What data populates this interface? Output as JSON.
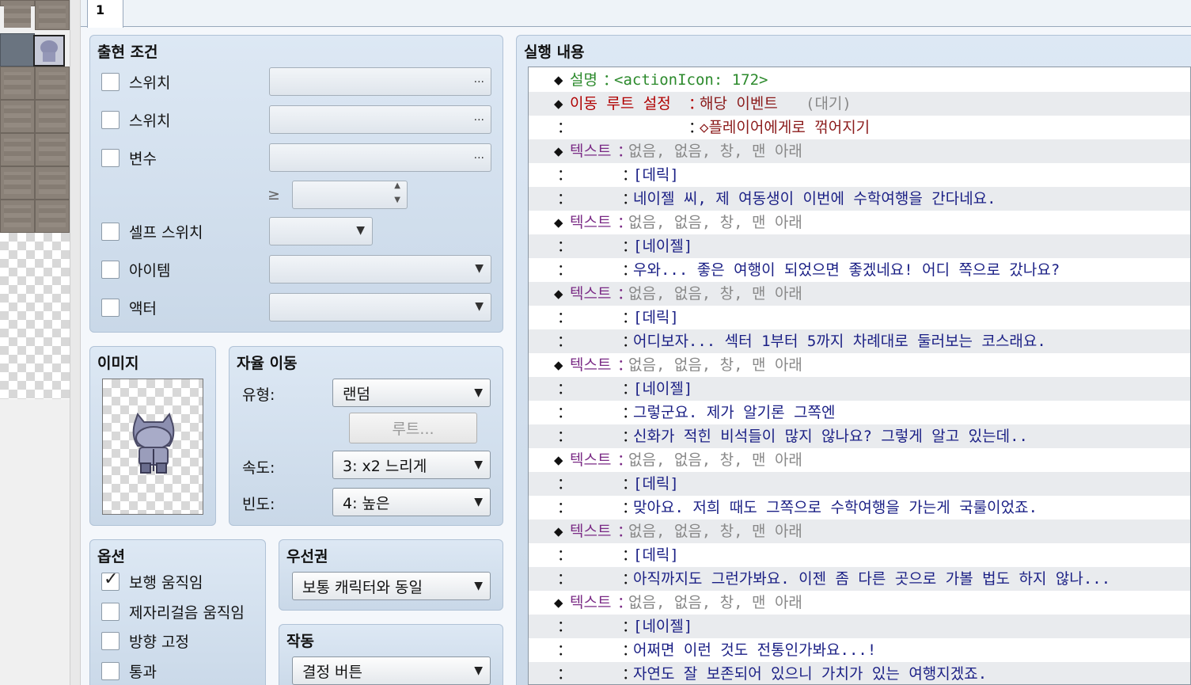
{
  "tab": {
    "label": "1"
  },
  "conditions": {
    "title": "출현 조건",
    "switch1": "스위치",
    "switch2": "스위치",
    "variable": "변수",
    "ge_symbol": "≥",
    "self_switch": "셀프 스위치",
    "item": "아이템",
    "actor": "액터",
    "dots": "..."
  },
  "image": {
    "title": "이미지"
  },
  "autonomous": {
    "title": "자율 이동",
    "type_label": "유형:",
    "type_value": "랜덤",
    "route_button": "루트...",
    "speed_label": "속도:",
    "speed_value": "3: x2 느리게",
    "freq_label": "빈도:",
    "freq_value": "4: 높은"
  },
  "options": {
    "title": "옵션",
    "walking": "보행 움직임",
    "stepping": "제자리걸음 움직임",
    "direction_fix": "방향 고정",
    "through": "통과",
    "walking_checked": true
  },
  "priority": {
    "title": "우선권",
    "value": "보통 캐릭터와 동일"
  },
  "trigger": {
    "title": "작동",
    "value": "결정 버튼"
  },
  "contents": {
    "title": "실행 내용",
    "rows": [
      {
        "bullet": "◆",
        "cmd": "설명",
        "style": "cmdg",
        "sep": "：",
        "args": "<actionIcon: 172>",
        "args_style": "cmdg",
        "extra": ""
      },
      {
        "bullet": "◆",
        "cmd": "이동 루트 설정",
        "style": "cmdr",
        "sep": "：",
        "args": "해당 이벤트 ",
        "args_style": "red",
        "extra": "(대기)"
      },
      {
        "bullet": "：",
        "cmd": "",
        "style": "cm",
        "sep": "：",
        "args": "◇플레이어에게로 꺾어지기",
        "args_style": "red",
        "extra": "",
        "indent": "wide"
      },
      {
        "bullet": "◆",
        "cmd": "텍스트",
        "style": "cmd",
        "sep": "：",
        "args": "없음, 없음, 창, 맨 아래",
        "args_style": "gray",
        "extra": ""
      },
      {
        "bullet": "：",
        "cmd": "",
        "style": "cm",
        "sep": "：",
        "args": "[데릭]",
        "args_style": "txt",
        "extra": ""
      },
      {
        "bullet": "：",
        "cmd": "",
        "style": "cm",
        "sep": "：",
        "args": "네이젤 씨, 제 여동생이 이번에 수학여행을 간다네요.",
        "args_style": "txt",
        "extra": ""
      },
      {
        "bullet": "◆",
        "cmd": "텍스트",
        "style": "cmd",
        "sep": "：",
        "args": "없음, 없음, 창, 맨 아래",
        "args_style": "gray",
        "extra": ""
      },
      {
        "bullet": "：",
        "cmd": "",
        "style": "cm",
        "sep": "：",
        "args": "[네이젤]",
        "args_style": "txt",
        "extra": ""
      },
      {
        "bullet": "：",
        "cmd": "",
        "style": "cm",
        "sep": "：",
        "args": "우와... 좋은 여행이 되었으면 좋겠네요! 어디 쪽으로 갔나요?",
        "args_style": "txt",
        "extra": ""
      },
      {
        "bullet": "◆",
        "cmd": "텍스트",
        "style": "cmd",
        "sep": "：",
        "args": "없음, 없음, 창, 맨 아래",
        "args_style": "gray",
        "extra": ""
      },
      {
        "bullet": "：",
        "cmd": "",
        "style": "cm",
        "sep": "：",
        "args": "[데릭]",
        "args_style": "txt",
        "extra": ""
      },
      {
        "bullet": "：",
        "cmd": "",
        "style": "cm",
        "sep": "：",
        "args": "어디보자... 섹터 1부터 5까지 차례대로 둘러보는 코스래요.",
        "args_style": "txt",
        "extra": ""
      },
      {
        "bullet": "◆",
        "cmd": "텍스트",
        "style": "cmd",
        "sep": "：",
        "args": "없음, 없음, 창, 맨 아래",
        "args_style": "gray",
        "extra": ""
      },
      {
        "bullet": "：",
        "cmd": "",
        "style": "cm",
        "sep": "：",
        "args": "[네이젤]",
        "args_style": "txt",
        "extra": ""
      },
      {
        "bullet": "：",
        "cmd": "",
        "style": "cm",
        "sep": "：",
        "args": "그렇군요. 제가 알기론 그쪽엔",
        "args_style": "txt",
        "extra": ""
      },
      {
        "bullet": "：",
        "cmd": "",
        "style": "cm",
        "sep": "：",
        "args": "신화가 적힌 비석들이 많지 않나요? 그렇게 알고 있는데..",
        "args_style": "txt",
        "extra": ""
      },
      {
        "bullet": "◆",
        "cmd": "텍스트",
        "style": "cmd",
        "sep": "：",
        "args": "없음, 없음, 창, 맨 아래",
        "args_style": "gray",
        "extra": ""
      },
      {
        "bullet": "：",
        "cmd": "",
        "style": "cm",
        "sep": "：",
        "args": "[데릭]",
        "args_style": "txt",
        "extra": ""
      },
      {
        "bullet": "：",
        "cmd": "",
        "style": "cm",
        "sep": "：",
        "args": "맞아요. 저희 때도 그쪽으로 수학여행을 가는게 국룰이었죠.",
        "args_style": "txt",
        "extra": ""
      },
      {
        "bullet": "◆",
        "cmd": "텍스트",
        "style": "cmd",
        "sep": "：",
        "args": "없음, 없음, 창, 맨 아래",
        "args_style": "gray",
        "extra": ""
      },
      {
        "bullet": "：",
        "cmd": "",
        "style": "cm",
        "sep": "：",
        "args": "[데릭]",
        "args_style": "txt",
        "extra": ""
      },
      {
        "bullet": "：",
        "cmd": "",
        "style": "cm",
        "sep": "：",
        "args": "아직까지도 그런가봐요. 이젠 좀 다른 곳으로 가볼 법도 하지 않나...",
        "args_style": "txt",
        "extra": ""
      },
      {
        "bullet": "◆",
        "cmd": "텍스트",
        "style": "cmd",
        "sep": "：",
        "args": "없음, 없음, 창, 맨 아래",
        "args_style": "gray",
        "extra": ""
      },
      {
        "bullet": "：",
        "cmd": "",
        "style": "cm",
        "sep": "：",
        "args": "[네이젤]",
        "args_style": "txt",
        "extra": ""
      },
      {
        "bullet": "：",
        "cmd": "",
        "style": "cm",
        "sep": "：",
        "args": "어쩌면 이런 것도 전통인가봐요...!",
        "args_style": "txt",
        "extra": ""
      },
      {
        "bullet": "：",
        "cmd": "",
        "style": "cm",
        "sep": "：",
        "args": "자연도 잘 보존되어 있으니 가치가 있는 여행지겠죠.",
        "args_style": "txt",
        "extra": ""
      }
    ]
  }
}
